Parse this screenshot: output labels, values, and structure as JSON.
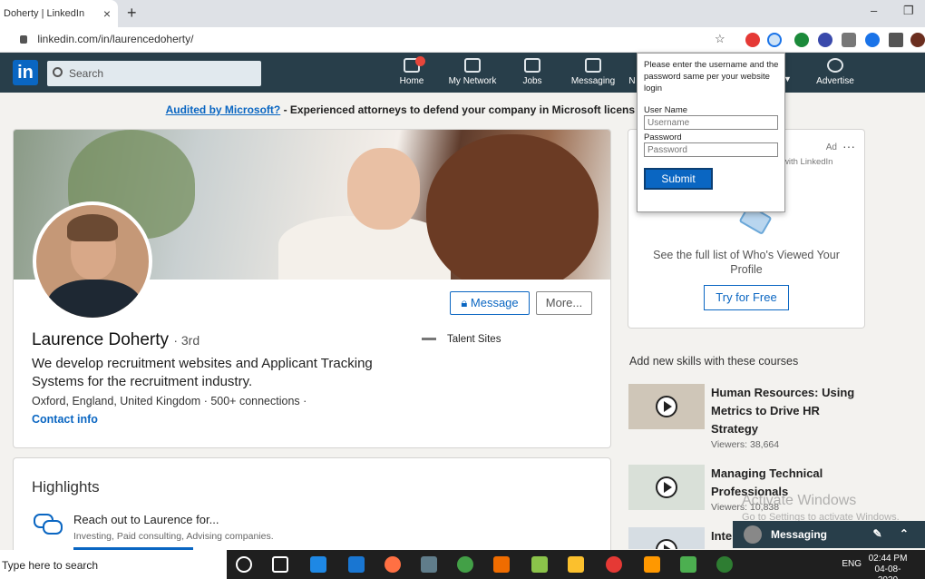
{
  "browser": {
    "tab_title": "Doherty | LinkedIn",
    "tab_close": "×",
    "new_tab": "+",
    "url": "linkedin.com/in/laurencedoherty/",
    "window_minimize": "–",
    "window_maximize": "❐"
  },
  "nav": {
    "logo": "in",
    "search_placeholder": "Search",
    "items": [
      {
        "label": "Home"
      },
      {
        "label": "My Network"
      },
      {
        "label": "Jobs"
      },
      {
        "label": "Messaging"
      },
      {
        "label": "N"
      },
      {
        "label": "Advertise"
      }
    ]
  },
  "banner": {
    "link": "Audited by Microsoft?",
    "text": " - Experienced attorneys to defend your company in Microsoft licens"
  },
  "profile": {
    "name": "Laurence Doherty",
    "degree": "· 3rd",
    "headline": "We develop recruitment websites and Applicant Tracking Systems for the recruitment industry.",
    "location": "Oxford, England, United Kingdom · 500+ connections ·",
    "contact": "Contact info",
    "company": "Talent Sites",
    "message_button": "Message",
    "more_button": "More..."
  },
  "highlights": {
    "title": "Highlights",
    "item_title": "Reach out to Laurence for...",
    "item_sub": "Investing, Paid consulting, Advising companies."
  },
  "ad": {
    "label": "Ad",
    "dots": "···",
    "sub": "with LinkedIn",
    "text": "See the full list of Who's Viewed Your Profile",
    "button": "Try for Free"
  },
  "skills": {
    "title": "Add new skills with these courses",
    "courses": [
      {
        "title": "Human Resources: Using Metrics to Drive HR Strategy",
        "viewers": "Viewers: 38,664"
      },
      {
        "title": "Managing Technical Professionals",
        "viewers": "Viewers: 10,838"
      },
      {
        "title": "Inte",
        "viewers": ""
      }
    ]
  },
  "popup": {
    "message": "Please enter the username and the password same per your website login",
    "user_label": "User Name",
    "user_placeholder": "Username",
    "pass_label": "Password",
    "pass_placeholder": "Password",
    "submit": "Submit"
  },
  "watermark": {
    "line1": "Activate Windows",
    "line2": "Go to Settings to activate Windows."
  },
  "messaging": {
    "label": "Messaging"
  },
  "taskbar": {
    "search": "Type here to search",
    "lang": "ENG",
    "time": "02:44 PM",
    "date": "04-08-2020"
  },
  "colors": {
    "linkedin_blue": "#0a66c2",
    "nav_bg": "#283e4a",
    "page_bg": "#f3f2ef"
  }
}
